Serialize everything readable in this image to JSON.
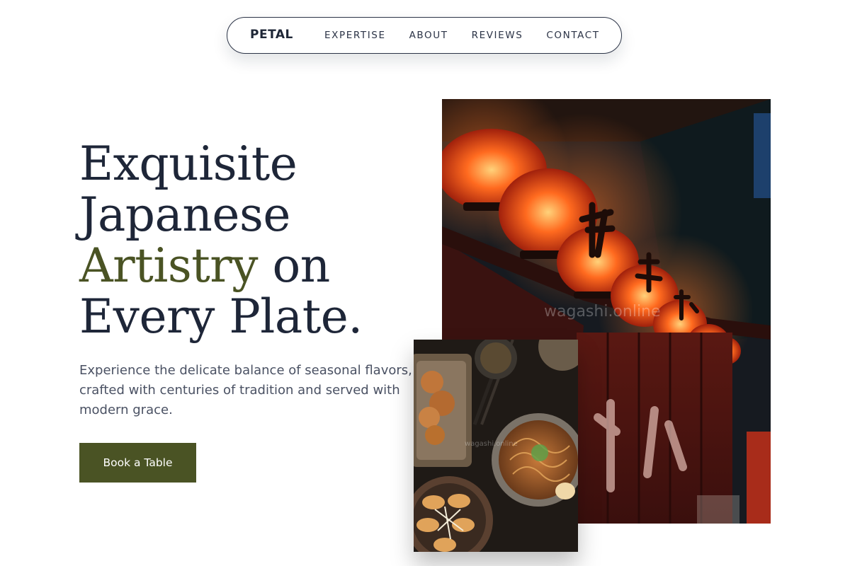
{
  "brand": "PETAL",
  "nav": {
    "links": [
      "EXPERTISE",
      "ABOUT",
      "REVIEWS",
      "CONTACT"
    ]
  },
  "hero": {
    "headline": {
      "line1": "Exquisite",
      "line2": "Japanese",
      "line3_accent": "Artistry",
      "line3_rest": " on",
      "line4": "Every Plate."
    },
    "subtext": "Experience the delicate balance of seasonal flavors, crafted with centuries of tradition and served with modern grace.",
    "cta_label": "Book a Table"
  },
  "images": {
    "main_alt": "Japanese street lanterns at night",
    "food_alt": "Japanese dishes: ramen, gyoza and karaage",
    "watermark": "wagashi.online"
  },
  "colors": {
    "text_dark": "#1e2638",
    "accent_olive": "#4a5324",
    "body_gray": "#4a5163",
    "nav_border": "#2b3346"
  }
}
